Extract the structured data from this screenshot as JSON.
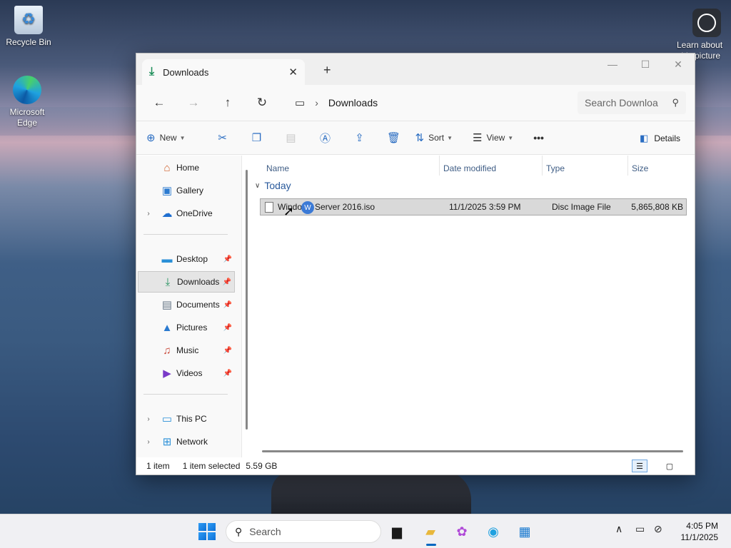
{
  "desktop": {
    "icons": [
      {
        "label": "Recycle Bin"
      },
      {
        "label": "Microsoft Edge"
      },
      {
        "label": "Learn about this picture"
      }
    ]
  },
  "window": {
    "tab_title": "Downloads",
    "new_tab": "+",
    "address": {
      "path": "Downloads",
      "search_placeholder": "Search Downloa"
    },
    "toolbar": {
      "new_label": "New",
      "sort_label": "Sort",
      "view_label": "View",
      "more_label": "•••",
      "details_label": "Details"
    },
    "sidebar": {
      "items": [
        {
          "label": "Home",
          "icon": "home-icon"
        },
        {
          "label": "Gallery",
          "icon": "gallery-icon"
        },
        {
          "label": "OneDrive",
          "icon": "onedrive-icon"
        },
        {
          "label": "Desktop",
          "icon": "desktop-icon"
        },
        {
          "label": "Downloads",
          "icon": "downloads-icon"
        },
        {
          "label": "Documents",
          "icon": "documents-icon"
        },
        {
          "label": "Pictures",
          "icon": "pictures-icon"
        },
        {
          "label": "Music",
          "icon": "music-icon"
        },
        {
          "label": "Videos",
          "icon": "videos-icon"
        },
        {
          "label": "This PC",
          "icon": "this-pc-icon"
        },
        {
          "label": "Network",
          "icon": "network-icon"
        }
      ]
    },
    "columns": {
      "name": "Name",
      "date": "Date modified",
      "type": "Type",
      "size": "Size"
    },
    "group": "Today",
    "files": [
      {
        "name": "Windows Server 2016.iso",
        "name_visible": "Windo",
        "name_rest": "Server 2016.iso",
        "date": "11/1/2025 3:59 PM",
        "type": "Disc Image File",
        "size": "5,865,808 KB"
      }
    ],
    "status": {
      "count": "1 item",
      "selected": "1 item selected",
      "size": "5.59 GB"
    }
  },
  "taskbar": {
    "search_placeholder": "Search",
    "time": "4:05 PM",
    "date": "11/1/2025"
  }
}
